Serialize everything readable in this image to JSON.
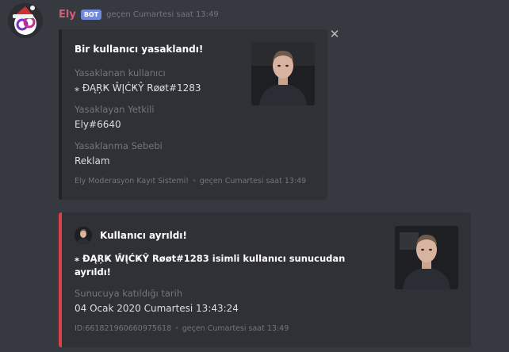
{
  "message": {
    "username": "Ely",
    "bot_tag": "BOT",
    "timestamp": "geçen Cumartesi saat 13:49",
    "username_color": "#d25f7a"
  },
  "embed_ban": {
    "title": "Bir kullanıcı yasaklandı!",
    "fields": [
      {
        "name": "Yasaklanan kullanıcı",
        "value": "⁎ ÐĄŖҜ ŴĮĆҜŶ Røøt#1283"
      },
      {
        "name": "Yasaklayan Yetkili",
        "value": "Ely#6640"
      },
      {
        "name": "Yasaklanma Sebebi",
        "value": "Reklam"
      }
    ],
    "footer_text": "Ely Moderasyon Kayıt Sistemi!",
    "footer_time": "geçen Cumartesi saat 13:49",
    "border_color": "#202225"
  },
  "embed_leave": {
    "author": "Kullanıcı ayrıldı!",
    "description": "⁎ ÐĄŖҜ ŴĮĆҜŶ Røøt#1283 isimli kullanıcı sunucudan ayrıldı!",
    "field_name": "Sunucuya katıldığı tarih",
    "field_value": "04 Ocak 2020 Cumartesi 13:43:24",
    "footer_text": "ID:661821960660975618",
    "footer_time": "geçen Cumartesi saat 13:49",
    "border_color": "#e03f45"
  },
  "icons": {
    "close": "close-icon",
    "avatar": "bot-avatar",
    "thumbnail": "user-avatar-thumbnail"
  }
}
